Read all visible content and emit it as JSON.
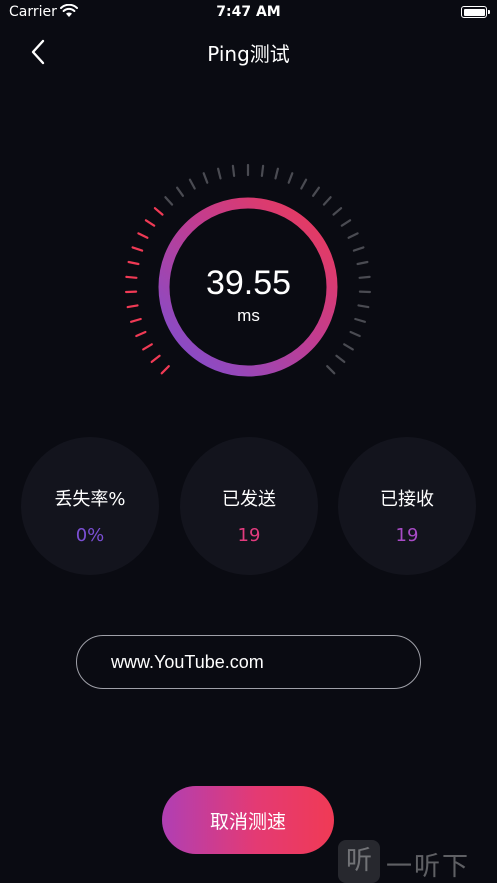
{
  "status_bar": {
    "carrier": "Carrier",
    "time": "7:47 AM"
  },
  "nav": {
    "title": "Ping测试"
  },
  "gauge": {
    "value": "39.55",
    "unit": "ms",
    "fill_fraction": 1.0
  },
  "stats": [
    {
      "label": "丢失率%",
      "value": "0%",
      "color": "#7b4fd4"
    },
    {
      "label": "已发送",
      "value": "19",
      "color": "#e23b7e"
    },
    {
      "label": "已接收",
      "value": "19",
      "color": "#a84bc6"
    }
  ],
  "host_input": {
    "value": "www.YouTube.com"
  },
  "cancel_button": {
    "label": "取消测速"
  },
  "watermark": {
    "logo": "听",
    "text": "一听下载"
  },
  "colors": {
    "background": "#0a0b12",
    "accent_red": "#f03a55",
    "accent_purple": "#7b4fd4",
    "tick_inactive": "#4a4b52"
  }
}
